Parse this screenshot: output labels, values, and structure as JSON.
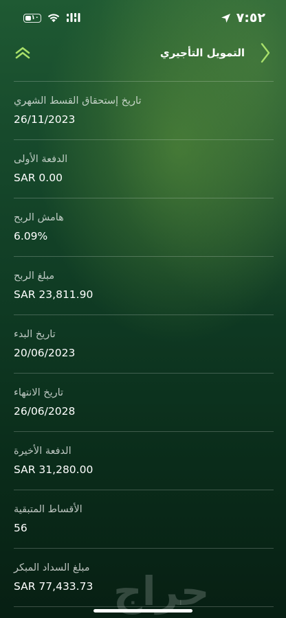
{
  "status_bar": {
    "time": "٧:٥٢",
    "battery_label": "١٠"
  },
  "header": {
    "title": "التمويل التأجيري"
  },
  "fields": [
    {
      "label": "تاريخ إستحقاق القسط الشهري",
      "value": "26/11/2023"
    },
    {
      "label": "الدفعة الأولى",
      "value": "SAR 0.00"
    },
    {
      "label": "هامش الربح",
      "value": "6.09%"
    },
    {
      "label": "مبلغ الربح",
      "value": "SAR 23,811.90"
    },
    {
      "label": "تاريخ البدء",
      "value": "20/06/2023"
    },
    {
      "label": "تاريخ الانتهاء",
      "value": "26/06/2028"
    },
    {
      "label": "الدفعة الأخيرة",
      "value": "SAR 31,280.00"
    },
    {
      "label": "الأقساط المتبقية",
      "value": "56"
    },
    {
      "label": "مبلغ السداد المبكر",
      "value": "SAR 77,433.73"
    }
  ],
  "colors": {
    "accent": "#a8e06a",
    "background_top": "#1f5a33",
    "background_bottom": "#071f13"
  },
  "icons": {
    "back": "chevron-right-icon",
    "collapse": "double-chevron-up-icon"
  }
}
